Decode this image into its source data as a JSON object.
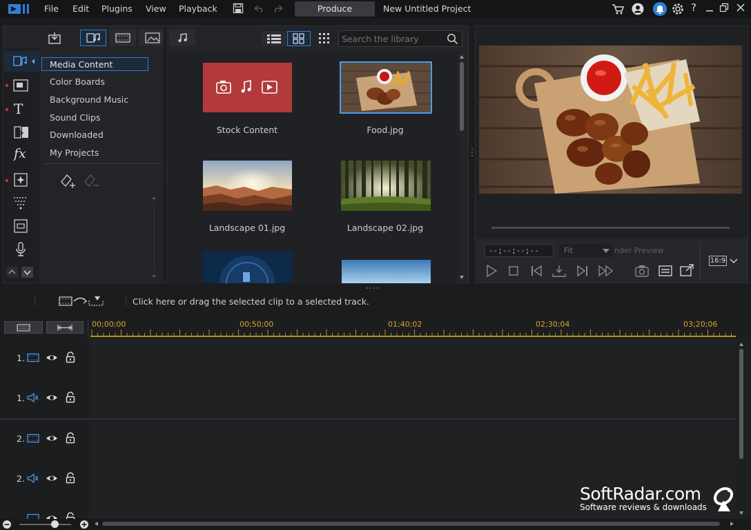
{
  "menu": {
    "items": [
      "File",
      "Edit",
      "Plugins",
      "View",
      "Playback"
    ],
    "produce_label": "Produce",
    "project_title": "New Untitled Project"
  },
  "library": {
    "search_placeholder": "Search the library",
    "rooms": [
      "Media Content",
      "Color Boards",
      "Background Music",
      "Sound Clips",
      "Downloaded",
      "My Projects"
    ],
    "selected_room": "Media Content",
    "media_items": [
      {
        "label": "Stock Content",
        "icon": "stock-content-icon"
      },
      {
        "label": "Food.jpg",
        "icon": "food-thumbnail"
      },
      {
        "label": "Landscape 01.jpg",
        "icon": "canyon-thumbnail"
      },
      {
        "label": "Landscape 02.jpg",
        "icon": "forest-thumbnail"
      }
    ]
  },
  "preview": {
    "timecode": "--;--;--;--",
    "fit": "Fit",
    "render_preview": "nder Preview",
    "aspect_ratio": "16:9"
  },
  "hint": {
    "text": "Click here or drag the selected clip to a selected track."
  },
  "timeline": {
    "ticks": [
      "00;00;00",
      "00;50;00",
      "01;40;02",
      "02;30;04",
      "03;20;06"
    ],
    "tracks": [
      {
        "num": "1.",
        "type": "video"
      },
      {
        "num": "1.",
        "type": "audio"
      },
      {
        "num": "2.",
        "type": "video"
      },
      {
        "num": "2.",
        "type": "audio"
      }
    ]
  },
  "watermark": {
    "title": "SoftRadar.com",
    "subtitle": "Software reviews & downloads"
  },
  "colors": {
    "accent_blue": "#2f7fd8",
    "timeline_yellow": "#d4a72c",
    "stock_red": "#b23a3a"
  }
}
